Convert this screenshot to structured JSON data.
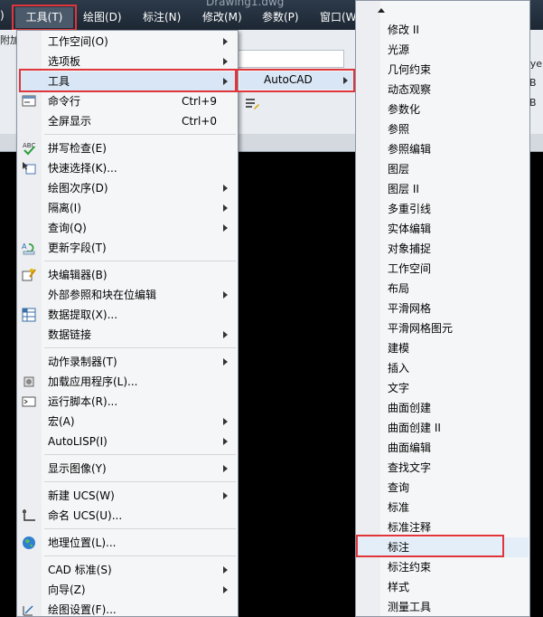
{
  "window": {
    "title": "Drawing1.dwg"
  },
  "menubar": {
    "items": [
      {
        "label": ")"
      },
      {
        "label": "工具(T)"
      },
      {
        "label": "绘图(D)"
      },
      {
        "label": "标注(N)"
      },
      {
        "label": "修改(M)"
      },
      {
        "label": "参数(P)"
      },
      {
        "label": "窗口(W"
      }
    ]
  },
  "ribbon": {
    "partial_label": "附加",
    "layer_text": "aye",
    "b1": "B",
    "b2": "B"
  },
  "tools_menu": {
    "items": [
      {
        "label": "工作空间(O)",
        "has_submenu": true
      },
      {
        "label": "选项板",
        "has_submenu": true
      },
      {
        "label": "工具",
        "has_submenu": true,
        "active": true
      },
      {
        "label": "命令行",
        "shortcut": "Ctrl+9",
        "icon": "command-line-icon"
      },
      {
        "label": "全屏显示",
        "shortcut": "Ctrl+0"
      },
      {
        "label": "拼写检查(E)",
        "icon": "spell-check-icon"
      },
      {
        "label": "快速选择(K)...",
        "icon": "quick-select-icon"
      },
      {
        "label": "绘图次序(D)",
        "has_submenu": true
      },
      {
        "label": "隔离(I)",
        "has_submenu": true
      },
      {
        "label": "查询(Q)",
        "has_submenu": true
      },
      {
        "label": "更新字段(T)",
        "icon": "update-field-icon"
      },
      {
        "label": "块编辑器(B)",
        "icon": "block-editor-icon"
      },
      {
        "label": "外部参照和块在位编辑",
        "has_submenu": true
      },
      {
        "label": "数据提取(X)...",
        "icon": "data-extract-icon"
      },
      {
        "label": "数据链接",
        "has_submenu": true
      },
      {
        "label": "动作录制器(T)",
        "has_submenu": true
      },
      {
        "label": "加载应用程序(L)...",
        "icon": "load-app-icon"
      },
      {
        "label": "运行脚本(R)...",
        "icon": "run-script-icon"
      },
      {
        "label": "宏(A)",
        "has_submenu": true
      },
      {
        "label": "AutoLISP(I)",
        "has_submenu": true
      },
      {
        "label": "显示图像(Y)",
        "has_submenu": true
      },
      {
        "label": "新建 UCS(W)",
        "has_submenu": true
      },
      {
        "label": "命名 UCS(U)...",
        "icon": "named-ucs-icon"
      },
      {
        "label": "地理位置(L)...",
        "icon": "globe-icon"
      },
      {
        "label": "CAD 标准(S)",
        "has_submenu": true
      },
      {
        "label": "向导(Z)",
        "has_submenu": true
      },
      {
        "label": "绘图设置(F)...",
        "icon": "drafting-settings-icon"
      }
    ]
  },
  "autocad_submenu": {
    "label": "AutoCAD"
  },
  "toolbar_list": {
    "items": [
      {
        "label": "修改 II"
      },
      {
        "label": "光源"
      },
      {
        "label": "几何约束"
      },
      {
        "label": "动态观察"
      },
      {
        "label": "参数化"
      },
      {
        "label": "参照"
      },
      {
        "label": "参照编辑"
      },
      {
        "label": "图层"
      },
      {
        "label": "图层 II"
      },
      {
        "label": "多重引线"
      },
      {
        "label": "实体编辑"
      },
      {
        "label": "对象捕捉"
      },
      {
        "label": "工作空间"
      },
      {
        "label": "布局"
      },
      {
        "label": "平滑网格"
      },
      {
        "label": "平滑网格图元"
      },
      {
        "label": "建模"
      },
      {
        "label": "插入"
      },
      {
        "label": "文字"
      },
      {
        "label": "曲面创建"
      },
      {
        "label": "曲面创建 II"
      },
      {
        "label": "曲面编辑"
      },
      {
        "label": "查找文字"
      },
      {
        "label": "查询"
      },
      {
        "label": "标准"
      },
      {
        "label": "标准注释"
      },
      {
        "label": "标注",
        "selected": true
      },
      {
        "label": "标注约束"
      },
      {
        "label": "样式"
      },
      {
        "label": "测量工具"
      }
    ]
  },
  "colors": {
    "highlight": "#e0353b",
    "menu_bg": "#f5f6f7",
    "active_row": "#d8e6f5"
  }
}
